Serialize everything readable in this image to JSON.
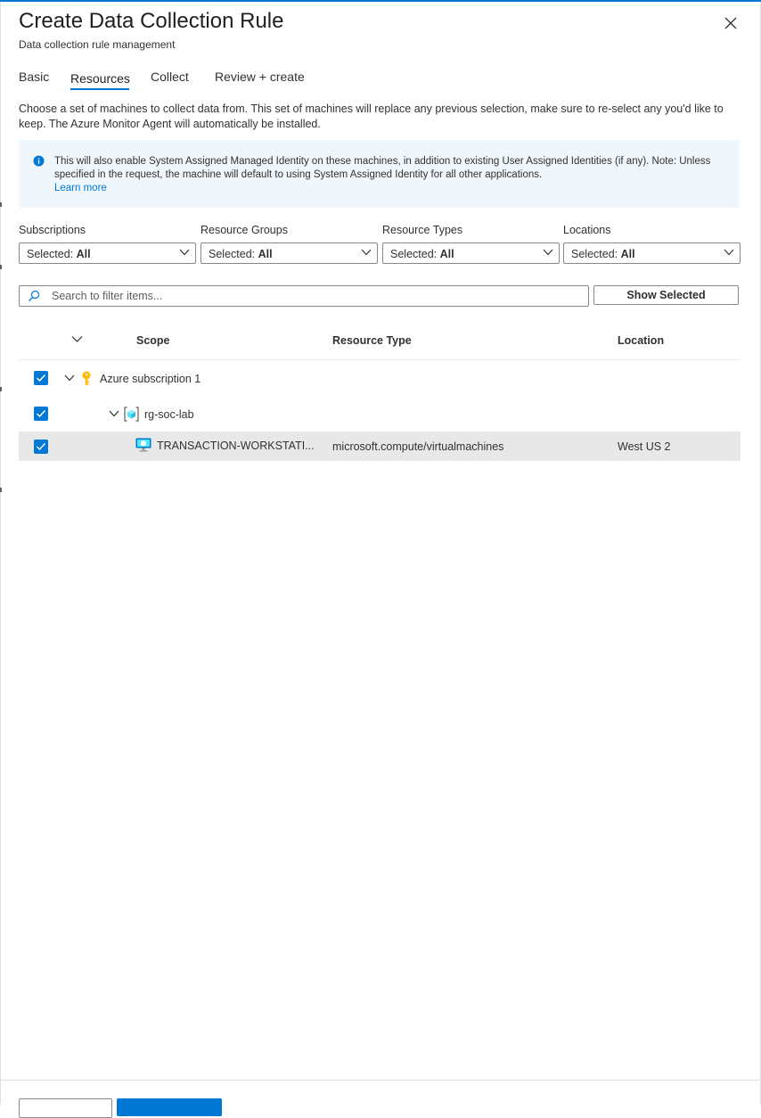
{
  "dialog": {
    "title": "Create Data Collection Rule",
    "subtitle": "Data collection rule management"
  },
  "tabs": [
    {
      "label": "Basic",
      "active": false
    },
    {
      "label": "Resources",
      "active": true
    },
    {
      "label": "Collect",
      "active": false
    },
    {
      "label": "Review + create",
      "active": false
    }
  ],
  "description": "Choose a set of machines to collect data from. This set of machines will replace any previous selection, make sure to re-select any you'd like to keep. The Azure Monitor Agent will automatically be installed.",
  "info": {
    "icon": "info-icon",
    "text": "This will also enable System Assigned Managed Identity on these machines, in addition to existing User Assigned Identities (if any). Note: Unless specified in the request, the machine will default to using System Assigned Identity for all other applications.",
    "link": "Learn more"
  },
  "filters": [
    {
      "label": "Subscriptions",
      "prefix": "Selected:",
      "value": "All"
    },
    {
      "label": "Resource Groups",
      "prefix": "Selected:",
      "value": "All"
    },
    {
      "label": "Resource Types",
      "prefix": "Selected:",
      "value": "All"
    },
    {
      "label": "Locations",
      "prefix": "Selected:",
      "value": "All"
    }
  ],
  "search": {
    "placeholder": "Search to filter items...",
    "value": ""
  },
  "show_selected_label": "Show Selected",
  "table": {
    "columns": [
      "Scope",
      "Resource Type",
      "Location"
    ],
    "rows": [
      {
        "level": 0,
        "checked": true,
        "expanded": true,
        "icon": "key-icon",
        "scope": "Azure subscription 1",
        "type": "",
        "location": ""
      },
      {
        "level": 1,
        "checked": true,
        "expanded": true,
        "icon": "resource-group-icon",
        "scope": "rg-soc-lab",
        "type": "",
        "location": ""
      },
      {
        "level": 2,
        "checked": true,
        "expanded": false,
        "icon": "virtual-machine-icon",
        "scope": "TRANSACTION-WORKSTATI...",
        "type": "microsoft.compute/virtualmachines",
        "location": "West US 2"
      }
    ]
  },
  "colors": {
    "accent": "#0078d4",
    "info_background": "#eff6fc",
    "selected_row": "#e8e8e8",
    "key_icon": "#ffb900"
  }
}
